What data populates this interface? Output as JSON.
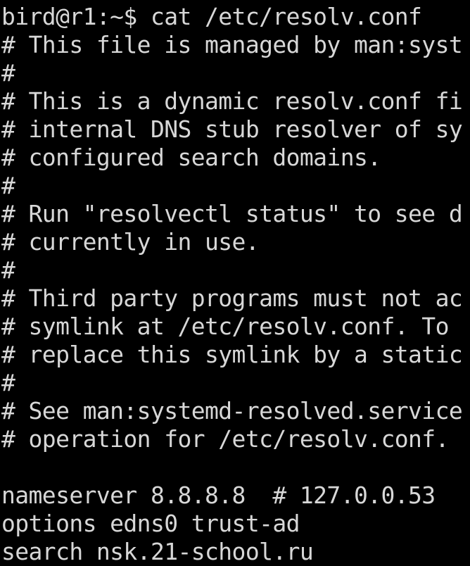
{
  "terminal": {
    "lines": [
      "bird@r1:~$ cat /etc/resolv.conf",
      "# This file is managed by man:syst",
      "#",
      "# This is a dynamic resolv.conf fi",
      "# internal DNS stub resolver of sy",
      "# configured search domains.",
      "#",
      "# Run \"resolvectl status\" to see d",
      "# currently in use.",
      "#",
      "# Third party programs must not ac",
      "# symlink at /etc/resolv.conf. To ",
      "# replace this symlink by a static",
      "#",
      "# See man:systemd-resolved.service",
      "# operation for /etc/resolv.conf.",
      "",
      "nameserver 8.8.8.8  # 127.0.0.53",
      "options edns0 trust-ad",
      "search nsk.21-school.ru"
    ]
  }
}
